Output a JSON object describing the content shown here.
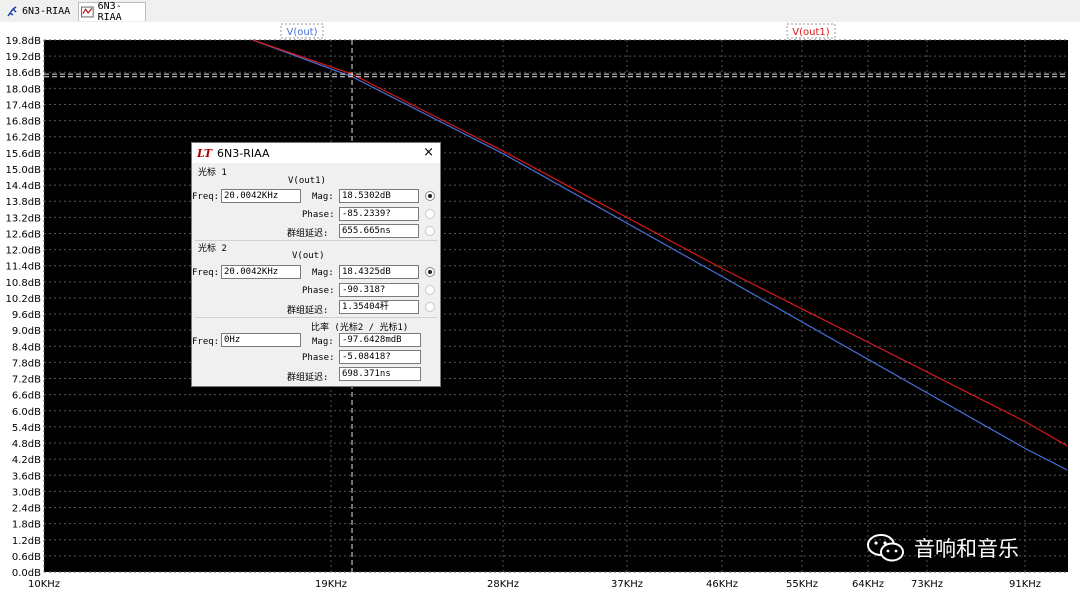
{
  "tabs": [
    {
      "label": "6N3-RIAA",
      "icon": "schematic-icon"
    },
    {
      "label": "6N3-RIAA",
      "icon": "waveform-icon"
    }
  ],
  "colors": {
    "background": "#000000",
    "grid": "#555555",
    "trace_out": "#4a6fd8",
    "trace_out1": "#d81818",
    "cursor": "#e6e6e6"
  },
  "chart_data": {
    "type": "line",
    "x_ticks": [
      "10KHz",
      "19KHz",
      "28KHz",
      "37KHz",
      "46KHz",
      "55KHz",
      "64KHz",
      "73KHz",
      "91KHz"
    ],
    "y_ticks": [
      "0.0dB",
      "0.6dB",
      "1.2dB",
      "1.8dB",
      "2.4dB",
      "3.0dB",
      "3.6dB",
      "4.2dB",
      "4.8dB",
      "5.4dB",
      "6.0dB",
      "6.6dB",
      "7.2dB",
      "7.8dB",
      "8.4dB",
      "9.0dB",
      "9.6dB",
      "10.2dB",
      "10.8dB",
      "11.4dB",
      "12.0dB",
      "12.6dB",
      "13.2dB",
      "13.8dB",
      "14.4dB",
      "15.0dB",
      "15.6dB",
      "16.2dB",
      "16.8dB",
      "17.4dB",
      "18.0dB",
      "18.6dB",
      "19.2dB",
      "19.8dB"
    ],
    "ylim": [
      0,
      19.8
    ],
    "grid": true,
    "series": [
      {
        "name": "V(out)",
        "x": [
          16.0,
          20.0042,
          28,
          46,
          91,
          100
        ],
        "y": [
          19.8,
          18.4325,
          15.6,
          11.0,
          4.6,
          3.8
        ]
      },
      {
        "name": "V(out1)",
        "x": [
          16.0,
          20.0042,
          28,
          46,
          91,
          100
        ],
        "y": [
          19.8,
          18.5302,
          15.7,
          11.3,
          5.6,
          4.7
        ]
      }
    ],
    "cursor": {
      "x": 20.0042,
      "y1": 18.5302,
      "y2": 18.4325
    }
  },
  "dialog": {
    "title": "6N3-RIAA",
    "close": "×",
    "cursor1": {
      "heading": "光标 1",
      "trace": "V(out1)",
      "freq_label": "Freq:",
      "freq": "20.0042KHz",
      "mag_label": "Mag:",
      "mag": "18.5302dB",
      "phase_label": "Phase:",
      "phase": "-85.2339?",
      "delay_label": "群组延迟:",
      "delay": "655.665ns"
    },
    "cursor2": {
      "heading": "光标 2",
      "trace": "V(out)",
      "freq_label": "Freq:",
      "freq": "20.0042KHz",
      "mag_label": "Mag:",
      "mag": "18.4325dB",
      "phase_label": "Phase:",
      "phase": "-90.318?",
      "delay_label": "群组延迟:",
      "delay": "1.35404秆"
    },
    "ratio": {
      "heading": "比率 (光标2 / 光标1)",
      "freq_label": "Freq:",
      "freq": "0Hz",
      "mag_label": "Mag:",
      "mag": "-97.6428mdB",
      "phase_label": "Phase:",
      "phase": "-5.08418?",
      "delay_label": "群组延迟:",
      "delay": "698.371ns"
    }
  },
  "watermark": "音响和音乐"
}
